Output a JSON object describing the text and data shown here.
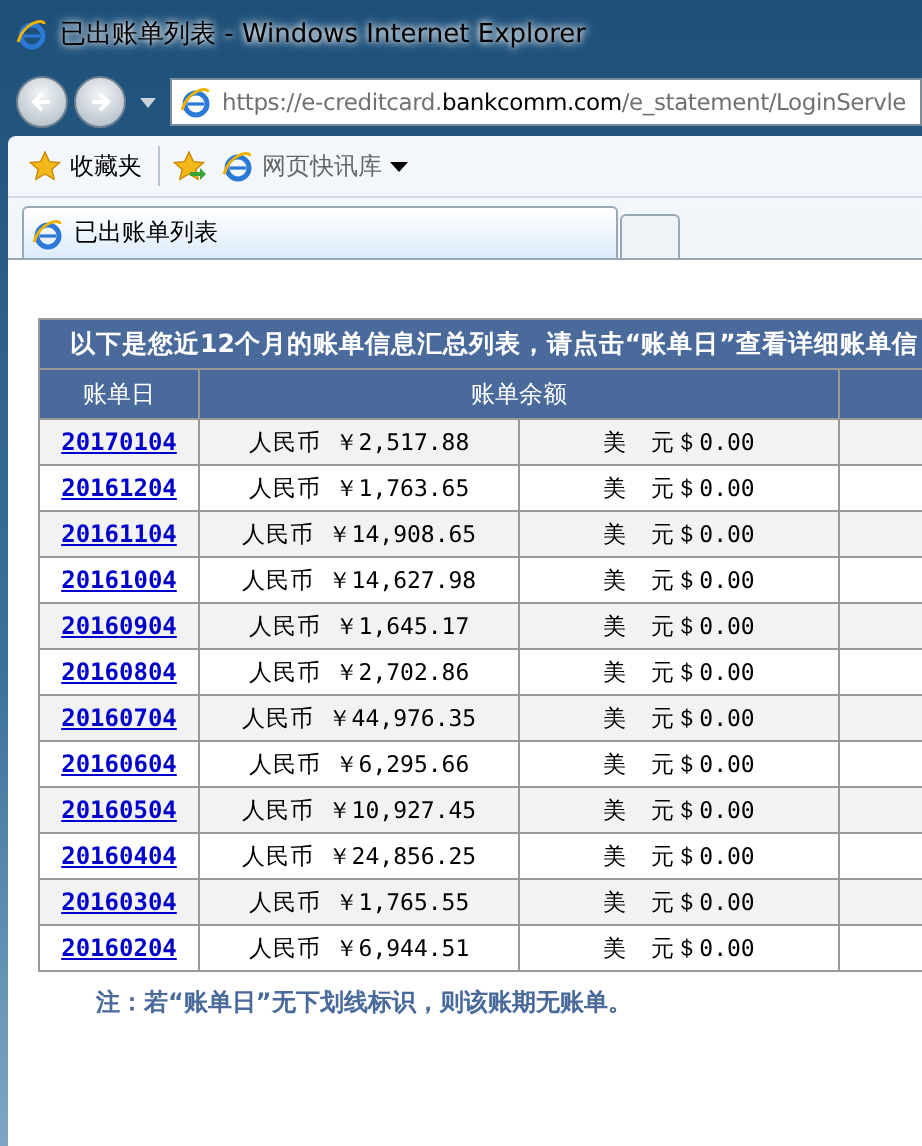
{
  "window": {
    "title": "已出账单列表 - Windows Internet Explorer"
  },
  "address_bar": {
    "url_prefix": "https://e-creditcard.",
    "url_domain": "bankcomm.com",
    "url_path": "/e_statement/LoginServle"
  },
  "favorites_bar": {
    "favorites": "收藏夹",
    "feeds": "网页快讯库"
  },
  "tabs": [
    {
      "label": "已出账单列表",
      "selected": true
    }
  ],
  "table": {
    "caption": "以下是您近12个月的账单信息汇总列表，请点击“账单日”查看详细账单信",
    "columns": [
      "账单日",
      "账单余额"
    ],
    "rows": [
      {
        "date": "20170104",
        "rmb": "人民币 ￥2,517.88",
        "usd": "美　元＄0.00"
      },
      {
        "date": "20161204",
        "rmb": "人民币 ￥1,763.65",
        "usd": "美　元＄0.00"
      },
      {
        "date": "20161104",
        "rmb": "人民币 ￥14,908.65",
        "usd": "美　元＄0.00"
      },
      {
        "date": "20161004",
        "rmb": "人民币 ￥14,627.98",
        "usd": "美　元＄0.00"
      },
      {
        "date": "20160904",
        "rmb": "人民币 ￥1,645.17",
        "usd": "美　元＄0.00"
      },
      {
        "date": "20160804",
        "rmb": "人民币 ￥2,702.86",
        "usd": "美　元＄0.00"
      },
      {
        "date": "20160704",
        "rmb": "人民币 ￥44,976.35",
        "usd": "美　元＄0.00"
      },
      {
        "date": "20160604",
        "rmb": "人民币 ￥6,295.66",
        "usd": "美　元＄0.00"
      },
      {
        "date": "20160504",
        "rmb": "人民币 ￥10,927.45",
        "usd": "美　元＄0.00"
      },
      {
        "date": "20160404",
        "rmb": "人民币 ￥24,856.25",
        "usd": "美　元＄0.00"
      },
      {
        "date": "20160304",
        "rmb": "人民币 ￥1,765.55",
        "usd": "美　元＄0.00"
      },
      {
        "date": "20160204",
        "rmb": "人民币 ￥6,944.51",
        "usd": "美　元＄0.00"
      }
    ]
  },
  "note": "注：若“账单日”无下划线标识，则该账期无账单。"
}
